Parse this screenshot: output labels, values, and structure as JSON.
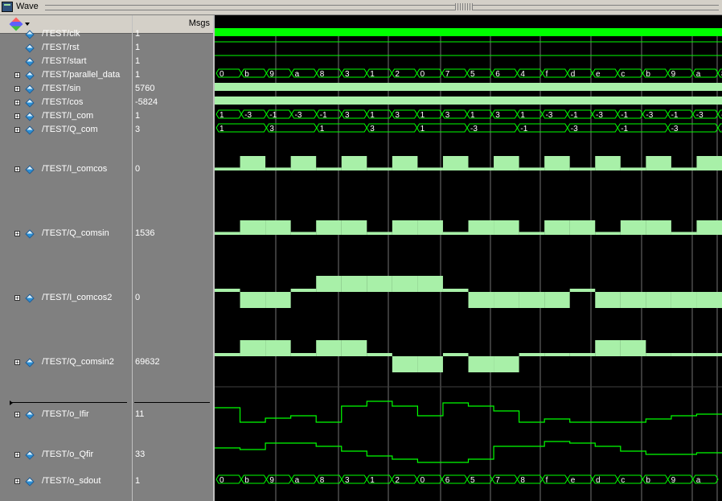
{
  "window": {
    "title": "Wave"
  },
  "header": {
    "msgs_label": "Msgs"
  },
  "colors": {
    "wave": "#00ff00",
    "bus_fill": "#a8f0a8",
    "grid": "#c0c0c0",
    "cursor": "#ffff00",
    "background": "#000000"
  },
  "signals": [
    {
      "name": "/TEST/clk",
      "value": "1",
      "expandable": false
    },
    {
      "name": "/TEST/rst",
      "value": "1",
      "expandable": false
    },
    {
      "name": "/TEST/start",
      "value": "1",
      "expandable": false
    },
    {
      "name": "/TEST/parallel_data",
      "value": "1",
      "expandable": true
    },
    {
      "name": "/TEST/sin",
      "value": "5760",
      "expandable": true
    },
    {
      "name": "/TEST/cos",
      "value": "-5824",
      "expandable": true
    },
    {
      "name": "/TEST/I_com",
      "value": "1",
      "expandable": true
    },
    {
      "name": "/TEST/Q_com",
      "value": "3",
      "expandable": true
    },
    {
      "name": "/TEST/I_comcos",
      "value": "0",
      "expandable": true
    },
    {
      "name": "/TEST/Q_comsin",
      "value": "1536",
      "expandable": true
    },
    {
      "name": "/TEST/I_comcos2",
      "value": "0",
      "expandable": true
    },
    {
      "name": "/TEST/Q_comsin2",
      "value": "69632",
      "expandable": true
    },
    {
      "name": "/TEST/o_Ifir",
      "value": "11",
      "expandable": true
    },
    {
      "name": "/TEST/o_Qfir",
      "value": "33",
      "expandable": true
    },
    {
      "name": "/TEST/o_sdout",
      "value": "1",
      "expandable": true
    }
  ],
  "buses": {
    "parallel_data": [
      "0",
      "b",
      "9",
      "a",
      "8",
      "3",
      "1",
      "2",
      "0",
      "7",
      "5",
      "6",
      "4",
      "f",
      "d",
      "e",
      "c",
      "b",
      "9",
      "a",
      "8"
    ],
    "I_com": [
      "1",
      "-3",
      "-1",
      "-3",
      "-1",
      "3",
      "1",
      "3",
      "1",
      "3",
      "1",
      "3",
      "1",
      "-3",
      "-1",
      "-3",
      "-1",
      "-3",
      "-1",
      "-3",
      "-1"
    ],
    "Q_com": [
      "1",
      "3",
      "1",
      "3",
      "1",
      "-3",
      "-1",
      "-3",
      "-1",
      "-3",
      "1"
    ],
    "o_sdout": [
      "0",
      "b",
      "9",
      "a",
      "8",
      "3",
      "1",
      "2",
      "0",
      "6",
      "5",
      "7",
      "8",
      "f",
      "e",
      "d",
      "c",
      "b",
      "9",
      "a"
    ]
  }
}
